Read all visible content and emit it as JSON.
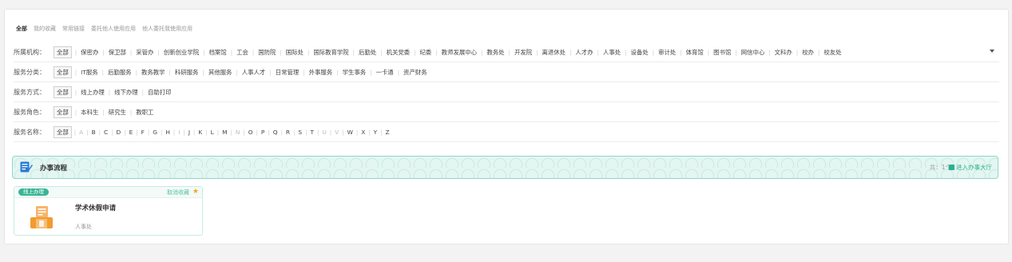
{
  "tabs": [
    "全部",
    "我的收藏",
    "常用链接",
    "委托他人使用应用",
    "他人委托我使用应用"
  ],
  "filters": {
    "institution": {
      "label": "所属机构：",
      "items": [
        "全部",
        "保密办",
        "保卫部",
        "采管办",
        "创新创业学院",
        "档案馆",
        "工会",
        "国防院",
        "国际处",
        "国际教育学院",
        "后勤处",
        "机关党委",
        "纪委",
        "教师发展中心",
        "教务处",
        "开发院",
        "离退休处",
        "人才办",
        "人事处",
        "设备处",
        "审计处",
        "体育馆",
        "图书馆",
        "网信中心",
        "文科办",
        "校办",
        "校友处"
      ]
    },
    "category": {
      "label": "服务分类：",
      "items": [
        "全部",
        "IT服务",
        "后勤服务",
        "教务教学",
        "科研服务",
        "其他服务",
        "人事人才",
        "日常管理",
        "外事服务",
        "学生事务",
        "一卡通",
        "资产财务"
      ]
    },
    "method": {
      "label": "服务方式：",
      "items": [
        "全部",
        "线上办理",
        "线下办理",
        "自助打印"
      ]
    },
    "role": {
      "label": "服务角色：",
      "items": [
        "全部",
        "本科生",
        "研究生",
        "教职工"
      ]
    },
    "name": {
      "label": "服务名称：",
      "items": [
        "全部",
        "A",
        "B",
        "C",
        "D",
        "E",
        "F",
        "G",
        "H",
        "I",
        "J",
        "K",
        "L",
        "M",
        "N",
        "O",
        "P",
        "Q",
        "R",
        "S",
        "T",
        "U",
        "V",
        "W",
        "X",
        "Y",
        "Z"
      ]
    }
  },
  "process": {
    "title": "办事流程",
    "count": "共：1个",
    "enter_label": "进入办事大厅"
  },
  "cards": [
    {
      "tag": "线上办理",
      "fav_label": "取消收藏",
      "title": "学术休假申请",
      "dept": "人事处"
    }
  ],
  "colors": {
    "accent": "#39b594",
    "process_bg": "#e4f6f1",
    "star": "#f5a623"
  }
}
